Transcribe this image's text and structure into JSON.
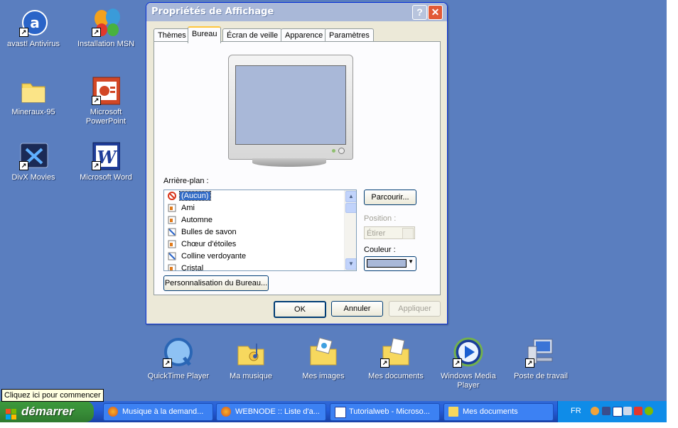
{
  "desktop": {
    "icons": [
      {
        "label": "avast! Antivirus"
      },
      {
        "label": "Installation MSN"
      },
      {
        "label": "Mineraux-95"
      },
      {
        "label": "Microsoft PowerPoint"
      },
      {
        "label": "DivX Movies"
      },
      {
        "label": "Microsoft Word"
      }
    ],
    "bottom_icons": [
      {
        "label": "QuickTime Player"
      },
      {
        "label": "Ma musique"
      },
      {
        "label": "Mes images"
      },
      {
        "label": "Mes documents"
      },
      {
        "label": "Windows Media Player"
      },
      {
        "label": "Poste de travail"
      }
    ],
    "shortcut_arrow": "↗"
  },
  "dialog": {
    "title": "Propriétés de Affichage",
    "help_label": "?",
    "close_label": "✕",
    "tabs": [
      {
        "label": "Thèmes"
      },
      {
        "label": "Bureau"
      },
      {
        "label": "Écran de veille"
      },
      {
        "label": "Apparence"
      },
      {
        "label": "Paramètres"
      }
    ],
    "active_tab": "Bureau",
    "background_label": "Arrière-plan :",
    "background_items": [
      {
        "label": "(Aucun)",
        "selected": true
      },
      {
        "label": "Ami"
      },
      {
        "label": "Automne"
      },
      {
        "label": "Bulles de savon"
      },
      {
        "label": "Chœur d'étoiles"
      },
      {
        "label": "Colline verdoyante"
      },
      {
        "label": "Cristal"
      }
    ],
    "browse_label": "Parcourir...",
    "position_label": "Position :",
    "position_value": "Étirer",
    "color_label": "Couleur :",
    "desktop_color": "#a9b8d8",
    "customize_label": "Personnalisation du Bureau...",
    "ok_label": "OK",
    "cancel_label": "Annuler",
    "apply_label": "Appliquer"
  },
  "tooltip": "Cliquez ici pour commencer",
  "taskbar": {
    "start_label": "démarrer",
    "tasks": [
      {
        "label": "Musique à la demand...",
        "icon": "firefox-icon"
      },
      {
        "label": "WEBNODE :: Liste d'a...",
        "icon": "firefox-icon"
      },
      {
        "label": "Tutorialweb - Microso...",
        "icon": "word-icon"
      },
      {
        "label": "Mes documents",
        "icon": "folder-icon"
      }
    ],
    "language": "FR"
  },
  "colors": {
    "desktop_bg": "#5a7ebf",
    "taskbar_blue": "#245edb",
    "start_green": "#388d38",
    "tray_blue": "#0f8ce8"
  }
}
